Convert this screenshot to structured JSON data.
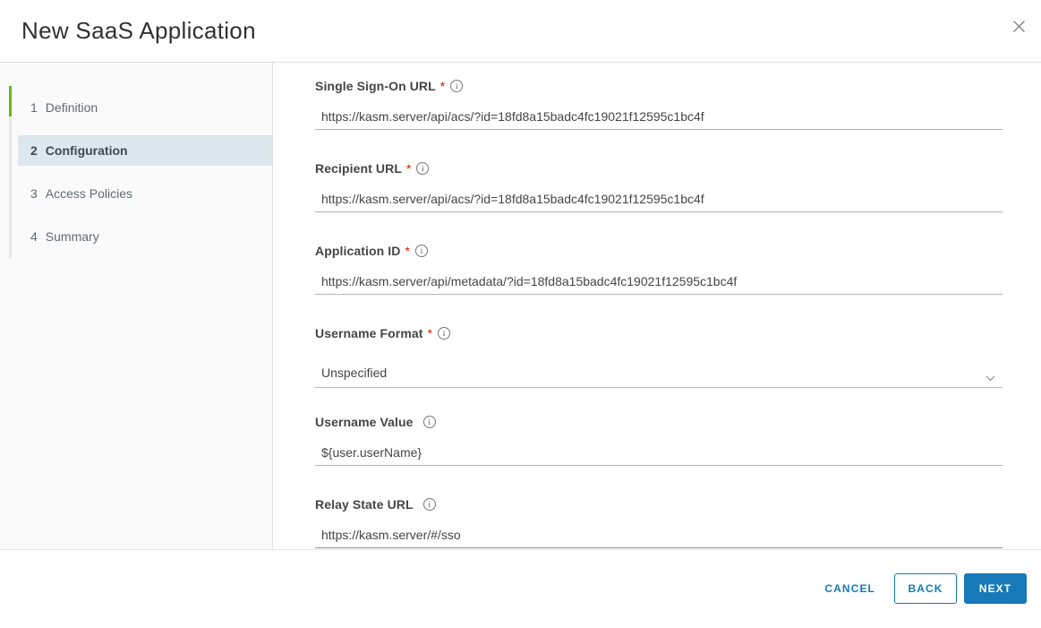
{
  "header": {
    "title": "New SaaS Application"
  },
  "icons": {
    "info": "i",
    "close": "close-x",
    "chevron_down": "chevron-down"
  },
  "colors": {
    "accent_blue": "#1779b8",
    "progress_green": "#61b715",
    "required_red": "#c92100",
    "active_step_bg": "#dde7ee",
    "sidebar_bg": "#fafafa"
  },
  "sidebar": {
    "steps": [
      {
        "number": "1",
        "label": "Definition",
        "state": "completed"
      },
      {
        "number": "2",
        "label": "Configuration",
        "state": "active"
      },
      {
        "number": "3",
        "label": "Access Policies",
        "state": "upcoming"
      },
      {
        "number": "4",
        "label": "Summary",
        "state": "upcoming"
      }
    ]
  },
  "form": {
    "fields": [
      {
        "label": "Single Sign-On URL",
        "required_mark": "*",
        "type": "text",
        "value": "https://kasm.server/api/acs/?id=18fd8a15badc4fc19021f12595c1bc4f"
      },
      {
        "label": "Recipient URL",
        "required_mark": "*",
        "type": "text",
        "value": "https://kasm.server/api/acs/?id=18fd8a15badc4fc19021f12595c1bc4f"
      },
      {
        "label": "Application ID",
        "required_mark": "*",
        "type": "text",
        "value": "https://kasm.server/api/metadata/?id=18fd8a15badc4fc19021f12595c1bc4f"
      },
      {
        "label": "Username Format",
        "required_mark": "*",
        "type": "select",
        "value": "Unspecified"
      },
      {
        "label": "Username Value",
        "required_mark": "",
        "type": "text",
        "value": "${user.userName}"
      },
      {
        "label": "Relay State URL",
        "required_mark": "",
        "type": "text",
        "value": "https://kasm.server/#/sso"
      }
    ]
  },
  "footer": {
    "cancel_label": "CANCEL",
    "back_label": "BACK",
    "next_label": "NEXT"
  }
}
